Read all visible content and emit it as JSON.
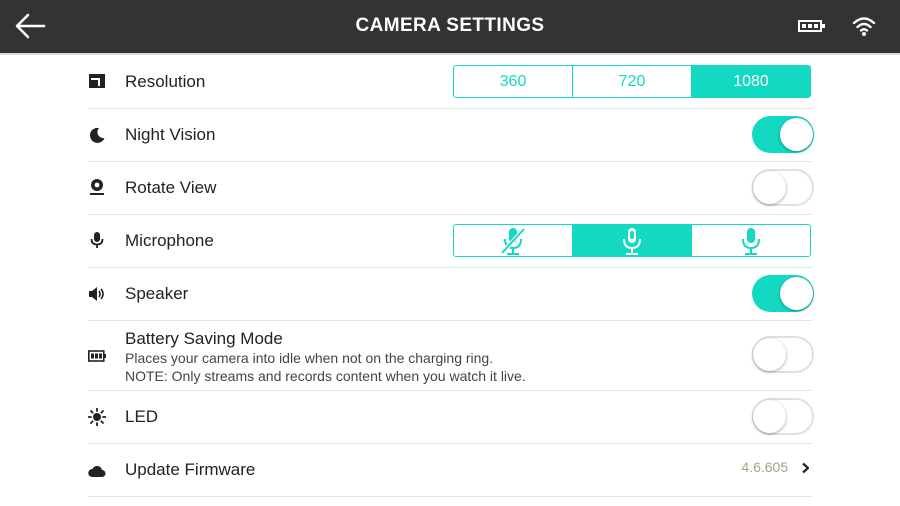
{
  "header": {
    "title": "CAMERA SETTINGS"
  },
  "settings": {
    "resolution": {
      "label": "Resolution",
      "options": [
        "360",
        "720",
        "1080"
      ],
      "selected": "1080"
    },
    "night_vision": {
      "label": "Night Vision",
      "on": true
    },
    "rotate_view": {
      "label": "Rotate View",
      "on": false
    },
    "microphone": {
      "label": "Microphone",
      "options": [
        "mic-muted-icon",
        "mic-icon",
        "mic-icon"
      ],
      "selected_index": 1
    },
    "speaker": {
      "label": "Speaker",
      "on": true
    },
    "battery_saving": {
      "label": "Battery Saving Mode",
      "description_line1": "Places your camera into idle when not on the charging ring.",
      "description_line2": "NOTE: Only streams and records content when you watch it live.",
      "on": false
    },
    "led": {
      "label": "LED",
      "on": false
    },
    "firmware": {
      "label": "Update Firmware",
      "version": "4.6.605"
    }
  },
  "colors": {
    "accent": "#14d9c2",
    "header_bg": "#333333",
    "version_text": "#a9a280"
  }
}
